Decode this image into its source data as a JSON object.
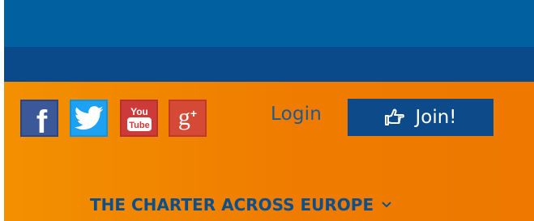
{
  "colors": {
    "header_blue": "#0060a0",
    "header_dark_blue": "#0a4a8a",
    "orange_left": "#f39000",
    "orange_right": "#ee7800",
    "join_bg": "#0c4a8a",
    "nav_text": "#0e4f8a"
  },
  "social": [
    {
      "icon": "facebook-icon",
      "brand_color": "#3b5998"
    },
    {
      "icon": "twitter-icon",
      "brand_color": "#1da1f2"
    },
    {
      "icon": "youtube-icon",
      "brand_color": "#cc3a3a"
    },
    {
      "icon": "google-plus-icon",
      "brand_color": "#d44a37"
    }
  ],
  "auth": {
    "login_label": "Login",
    "join_label": "Join!",
    "join_icon": "pointing-hand-icon"
  },
  "nav": {
    "charter_label": "THE CHARTER ACROSS EUROPE",
    "charter_icon": "chevron-down-icon"
  }
}
